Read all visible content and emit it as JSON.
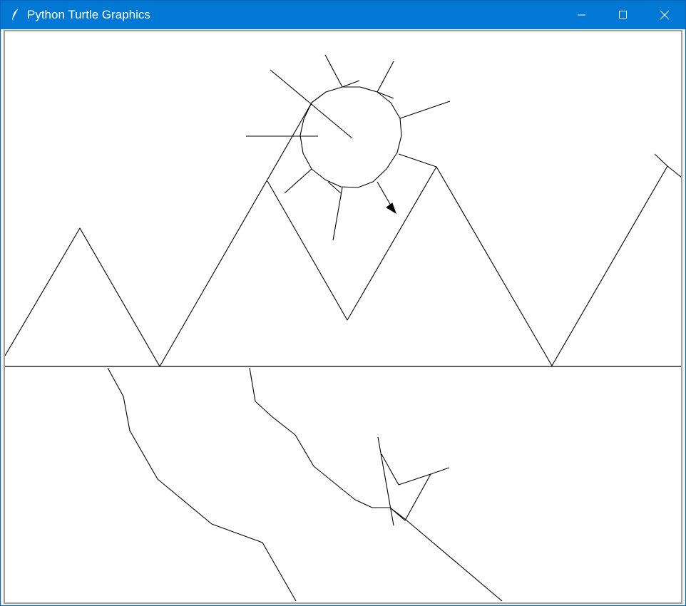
{
  "window": {
    "title": "Python Turtle Graphics",
    "icon": "feather-icon",
    "controls": [
      "minimize-icon",
      "maximize-icon",
      "close-icon"
    ]
  },
  "colors": {
    "titlebar": "#0078d4",
    "title_text": "#ffffff",
    "canvas_background": "#ffffff",
    "pen": "#000000"
  },
  "canvas": {
    "content": "turtle drawing: mountains, sun with rays, horizon line, river, bird",
    "turtle_cursor": "arrow"
  }
}
